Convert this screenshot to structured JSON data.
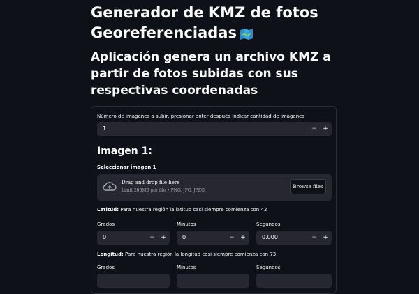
{
  "header": {
    "title": "Generador de KMZ de fotos Georeferenciadas",
    "title_icon": "map-icon",
    "subtitle": "Aplicación genera un archivo KMZ a partir de fotos subidas con sus respectivas coordenadas"
  },
  "images_count": {
    "label": "Número de imágenes a subir, presionar enter después indicar cantidad de imágenes",
    "value": "1",
    "minus": "−",
    "plus": "+"
  },
  "image_section": {
    "heading": "Imagen 1:",
    "uploader_label": "Seleccionar imagen 1",
    "drag_text": "Drag and drop file here",
    "limit_text": "Limit 200MB per file • PNG, JPG, JPEG",
    "browse_label": "Browse files"
  },
  "latitude": {
    "title": "Latitud:",
    "hint": "Para nuestra región la latitud casi siempre comienza con 42",
    "degrees_label": "Grados",
    "degrees_value": "0",
    "minutes_label": "Minutos",
    "minutes_value": "0",
    "seconds_label": "Segundos",
    "seconds_value": "0.000"
  },
  "longitude": {
    "title": "Longitud:",
    "hint": "Para nuestra región la longitud casi siempre comienza con 73",
    "degrees_label": "Grados",
    "minutes_label": "Minutos",
    "seconds_label": "Segundos"
  },
  "colors": {
    "background": "#0e1117",
    "input_bg": "#262730",
    "border": "#2b2e36",
    "text": "#fafafa"
  }
}
